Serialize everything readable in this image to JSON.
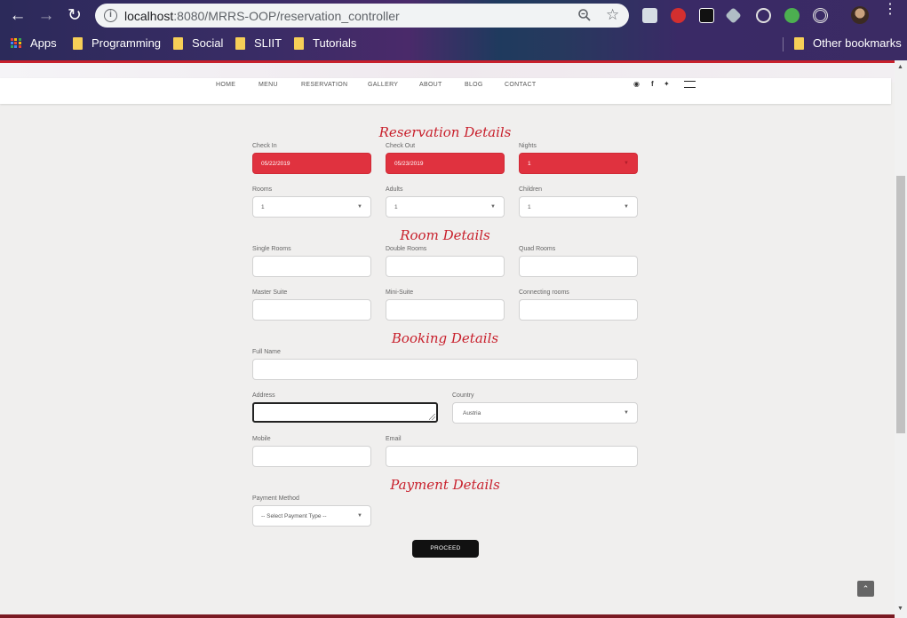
{
  "browser": {
    "url_host": "localhost",
    "url_rest": ":8080/MRRS-OOP/reservation_controller",
    "bookmarks": [
      "Apps",
      "Programming",
      "Social",
      "SLIIT",
      "Tutorials"
    ],
    "other_bookmarks": "Other bookmarks"
  },
  "nav": {
    "items": [
      "HOME",
      "MENU",
      "RESERVATION",
      "GALLERY",
      "ABOUT",
      "BLOG",
      "CONTACT"
    ],
    "social": [
      "tripadvisor-icon",
      "facebook-icon",
      "twitter-icon"
    ]
  },
  "reservation": {
    "title": "Reservation Details",
    "check_in_label": "Check In",
    "check_in_value": "05/22/2019",
    "check_out_label": "Check Out",
    "check_out_value": "05/23/2019",
    "nights_label": "Nights",
    "nights_value": "1",
    "rooms_label": "Rooms",
    "rooms_value": "1",
    "adults_label": "Adults",
    "adults_value": "1",
    "children_label": "Children",
    "children_value": "1"
  },
  "rooms": {
    "title": "Room Details",
    "single_label": "Single Rooms",
    "double_label": "Double Rooms",
    "quad_label": "Quad Rooms",
    "master_label": "Master Suite",
    "mini_label": "Mini-Suite",
    "connecting_label": "Connecting rooms"
  },
  "booking": {
    "title": "Booking Details",
    "full_name_label": "Full Name",
    "address_label": "Address",
    "country_label": "Country",
    "country_value": "Austria",
    "mobile_label": "Mobile",
    "email_label": "Email"
  },
  "payment": {
    "title": "Payment Details",
    "method_label": "Payment Method",
    "method_value": "-- Select Payment Type --",
    "proceed_label": "PROCEED"
  },
  "colors": {
    "accent": "#c8202c",
    "field_red": "#e0323f"
  }
}
